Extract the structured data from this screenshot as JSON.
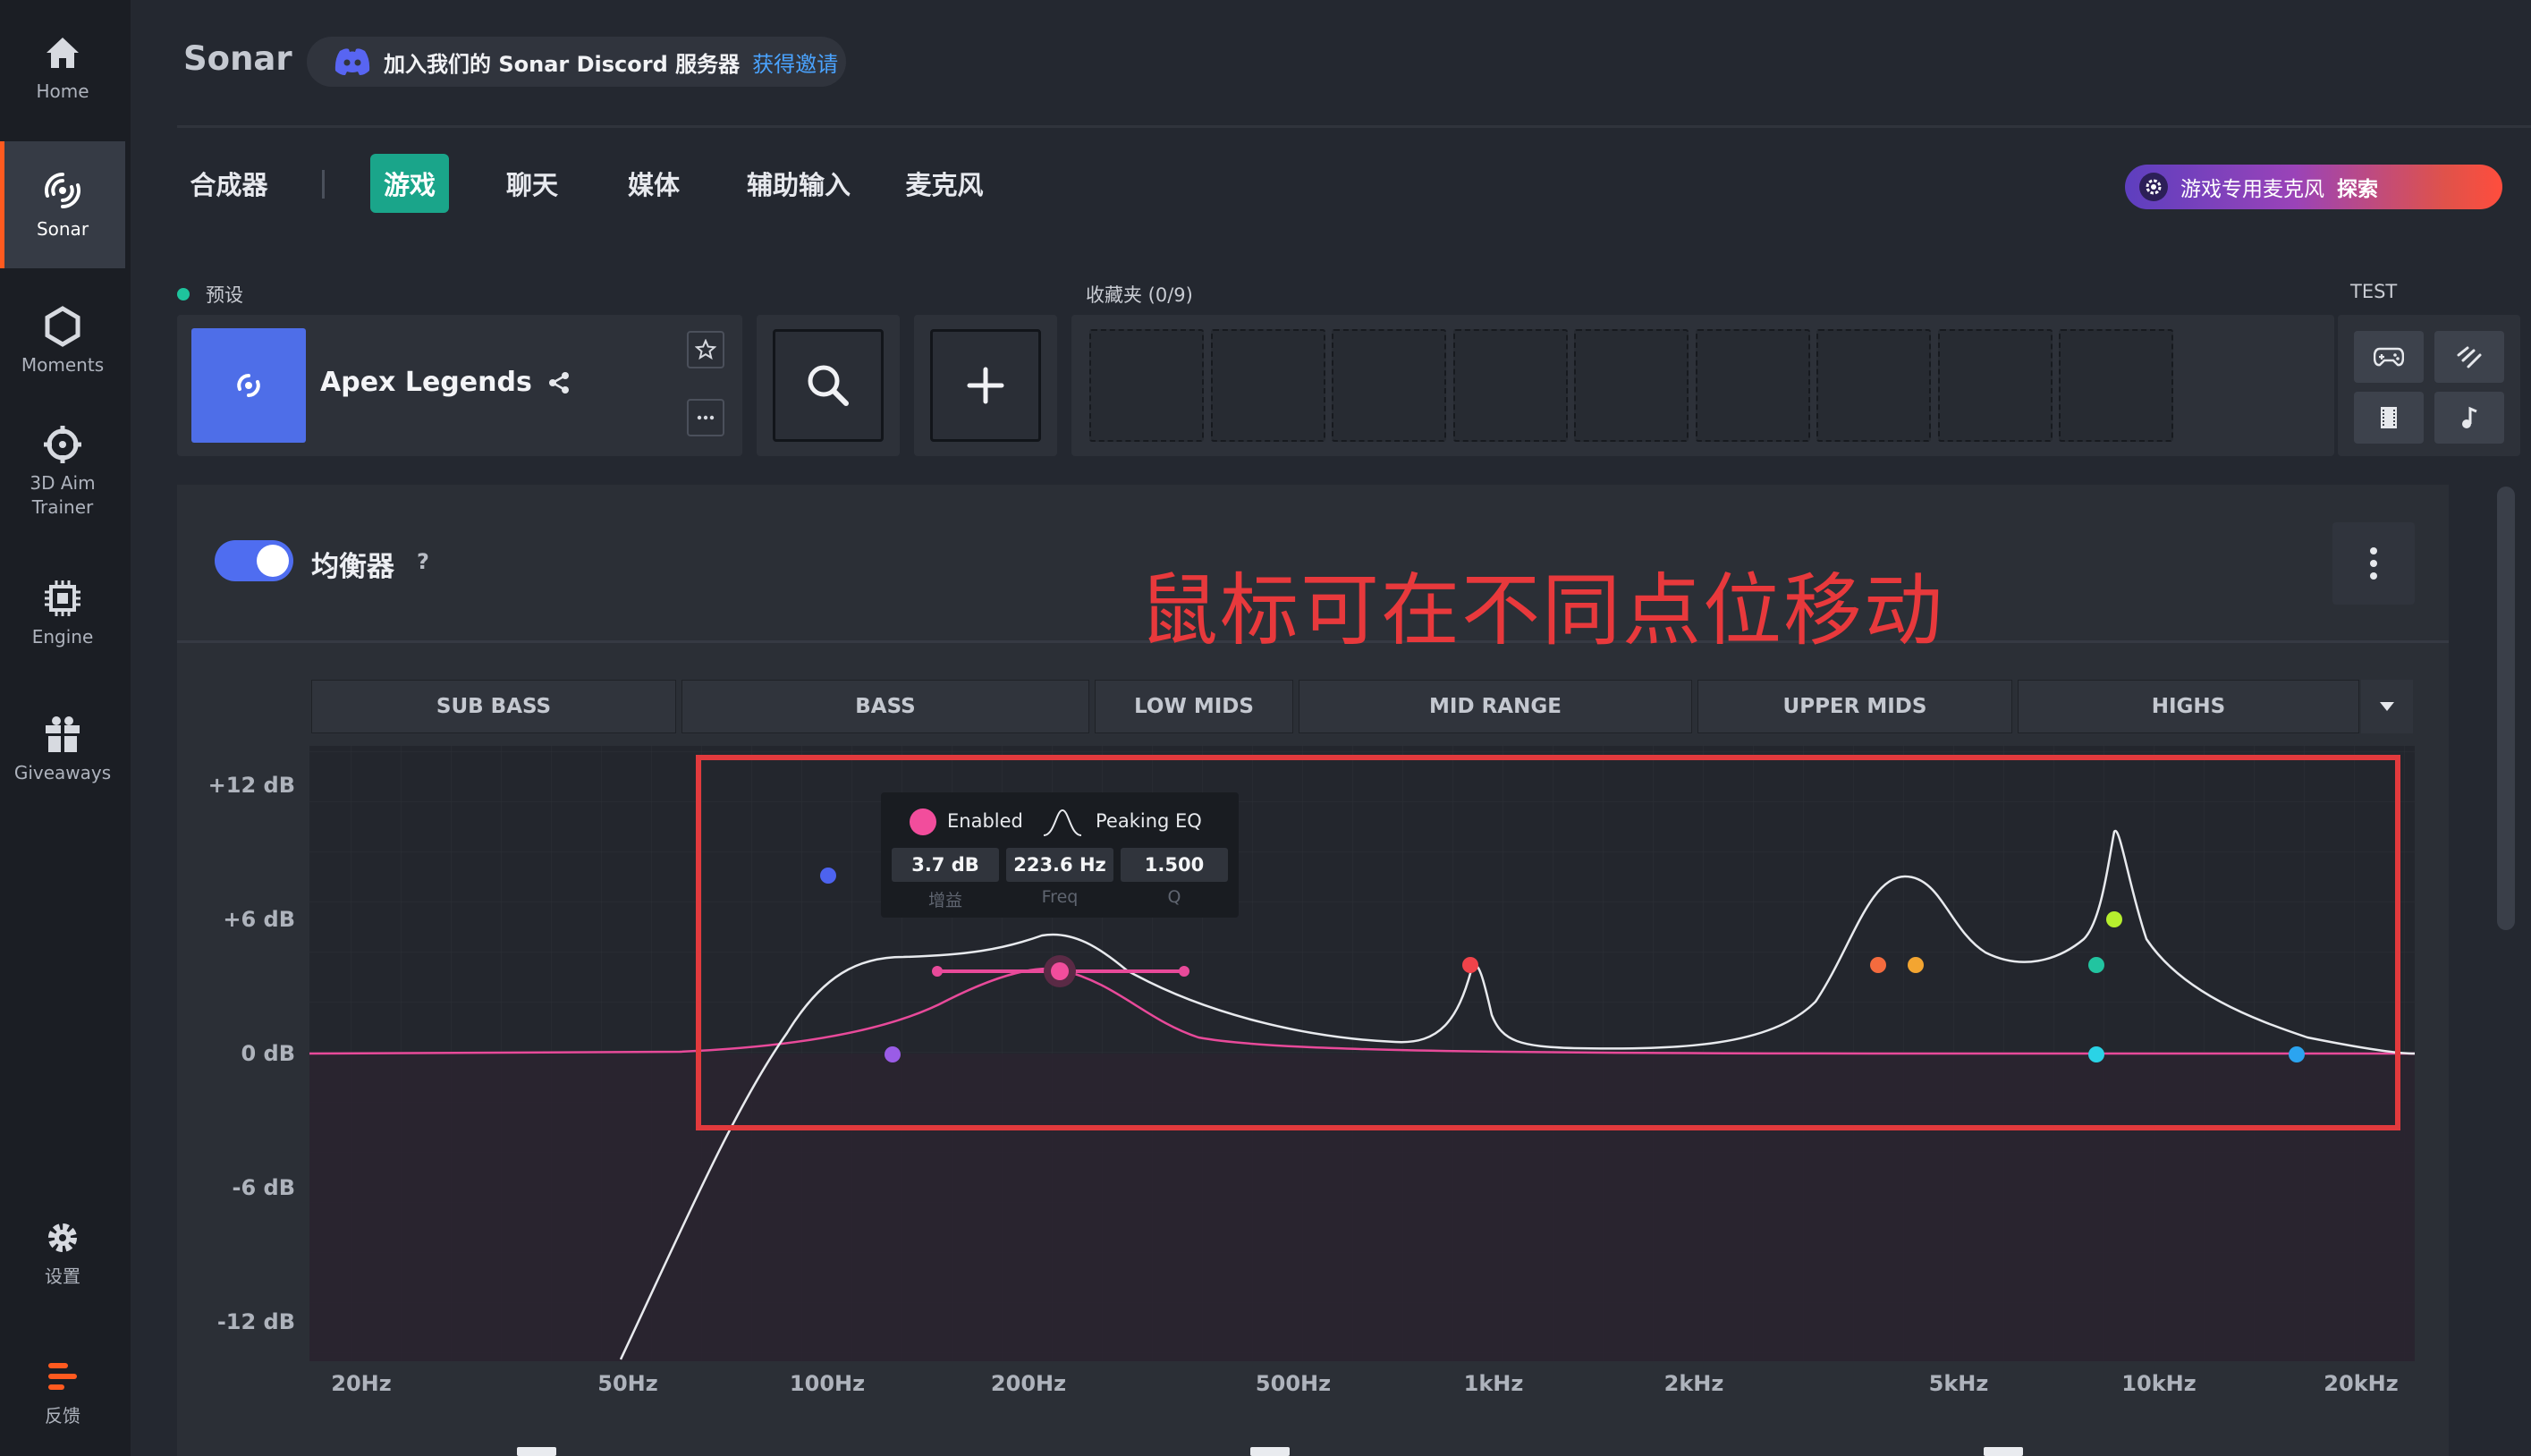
{
  "sidebar": {
    "items": [
      {
        "label": "Home",
        "icon": "home-icon"
      },
      {
        "label": "Sonar",
        "icon": "sonar-icon",
        "active": true
      },
      {
        "label": "Moments",
        "icon": "hexagon-icon"
      },
      {
        "label": "3D Aim Trainer",
        "line1": "3D Aim",
        "line2": "Trainer",
        "icon": "crosshair-icon"
      },
      {
        "label": "Engine",
        "icon": "chip-icon"
      },
      {
        "label": "Giveaways",
        "icon": "gift-icon"
      },
      {
        "label": "设置",
        "icon": "gear-icon"
      },
      {
        "label": "反馈",
        "icon": "feedback-icon"
      }
    ],
    "accent": "#ff5a1f"
  },
  "header": {
    "title": "Sonar",
    "discord_text": "加入我们的 Sonar Discord 服务器",
    "discord_link": "获得邀请"
  },
  "tabs": {
    "items": [
      "合成器",
      "游戏",
      "聊天",
      "媒体",
      "辅助输入",
      "麦克风"
    ],
    "active": "游戏",
    "active_color": "#1aa58a"
  },
  "promo": {
    "text": "游戏专用麦克风",
    "link": "探索"
  },
  "preset": {
    "label": "预设",
    "name": "Apex Legends"
  },
  "favorites": {
    "label": "收藏夹 (0/9)",
    "slots": 9
  },
  "test": {
    "label": "TEST"
  },
  "equalizer": {
    "title": "均衡器",
    "help": "?",
    "enabled": true,
    "bands": [
      "SUB BASS",
      "BASS",
      "LOW MIDS",
      "MID RANGE",
      "UPPER MIDS",
      "HIGHS"
    ],
    "y_labels": [
      "+12 dB",
      "+6 dB",
      "0 dB",
      "-6 dB",
      "-12 dB"
    ],
    "x_labels": [
      "20Hz",
      "50Hz",
      "100Hz",
      "200Hz",
      "500Hz",
      "1kHz",
      "2kHz",
      "5kHz",
      "10kHz",
      "20kHz"
    ],
    "tooltip": {
      "enabled_label": "Enabled",
      "filter_type": "Peaking EQ",
      "gain": "3.7 dB",
      "freq": "223.6 Hz",
      "q": "1.500",
      "gain_caption": "增益",
      "freq_caption": "Freq",
      "q_caption": "Q"
    },
    "annotation": "鼠标可在不同点位移动"
  }
}
